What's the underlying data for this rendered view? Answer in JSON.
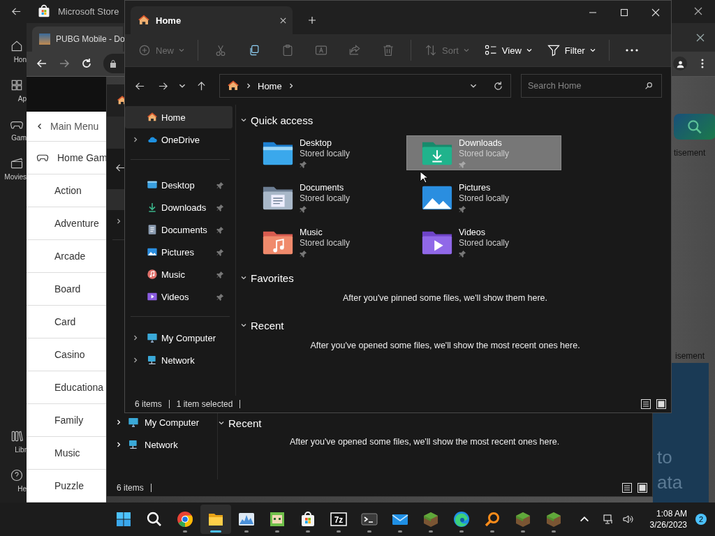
{
  "store": {
    "title": "Microsoft Store",
    "rail": [
      {
        "kind": "home",
        "label": "Hon"
      },
      {
        "kind": "apps",
        "label": "Ap"
      },
      {
        "kind": "gaming",
        "label": "Gam"
      },
      {
        "kind": "movies",
        "label": "Movies"
      }
    ],
    "rail_bottom": [
      {
        "kind": "library",
        "label": "Libr"
      },
      {
        "kind": "help",
        "label": "He"
      }
    ]
  },
  "browser": {
    "tab_title": "PUBG Mobile - Do",
    "menu": {
      "back_label": "Main Menu",
      "section_label": "Home Gam",
      "items": [
        "Action",
        "Adventure",
        "Arcade",
        "Board",
        "Card",
        "Casino",
        "Educationa",
        "Family",
        "Music",
        "Puzzle"
      ]
    },
    "page_snippets": [
      "tisement",
      "isement"
    ],
    "banner_lines": [
      "to",
      "ata"
    ]
  },
  "back_explorer": {
    "nav": [
      {
        "kind": "computer",
        "label": "My Computer"
      },
      {
        "kind": "network",
        "label": "Network"
      }
    ],
    "section": "Recent",
    "message": "After you've opened some files, we'll show the most recent ones here.",
    "status": "6 items"
  },
  "explorer": {
    "tab_title": "Home",
    "toolbar_groups": [
      [
        {
          "kind": "new",
          "label": "New",
          "disabled": true,
          "dropdown": true
        }
      ],
      [
        {
          "kind": "cut",
          "disabled": true
        },
        {
          "kind": "copy",
          "disabled": false
        },
        {
          "kind": "paste",
          "disabled": true
        },
        {
          "kind": "rename",
          "disabled": true
        },
        {
          "kind": "share",
          "disabled": true
        },
        {
          "kind": "delete",
          "disabled": true
        }
      ],
      [
        {
          "kind": "sort",
          "label": "Sort",
          "disabled": true,
          "dropdown": true
        },
        {
          "kind": "view",
          "label": "View",
          "disabled": false,
          "dropdown": true
        },
        {
          "kind": "filter",
          "label": "Filter",
          "disabled": false,
          "dropdown": true
        }
      ],
      [
        {
          "kind": "more",
          "disabled": false
        }
      ]
    ],
    "address": "Home",
    "search_placeholder": "Search Home",
    "nav_groups": [
      [
        {
          "kind": "home",
          "label": "Home",
          "selected": true,
          "expandable": false,
          "pinned": false
        },
        {
          "kind": "onedrive",
          "label": "OneDrive",
          "selected": false,
          "expandable": true,
          "pinned": false
        }
      ],
      [
        {
          "kind": "desktop",
          "label": "Desktop",
          "selected": false,
          "expandable": false,
          "pinned": true
        },
        {
          "kind": "downloads",
          "label": "Downloads",
          "selected": false,
          "expandable": false,
          "pinned": true
        },
        {
          "kind": "documents",
          "label": "Documents",
          "selected": false,
          "expandable": false,
          "pinned": true
        },
        {
          "kind": "pictures",
          "label": "Pictures",
          "selected": false,
          "expandable": false,
          "pinned": true
        },
        {
          "kind": "music",
          "label": "Music",
          "selected": false,
          "expandable": false,
          "pinned": true
        },
        {
          "kind": "videos",
          "label": "Videos",
          "selected": false,
          "expandable": false,
          "pinned": true
        }
      ],
      [
        {
          "kind": "computer",
          "label": "My Computer",
          "selected": false,
          "expandable": true,
          "pinned": false
        },
        {
          "kind": "network",
          "label": "Network",
          "selected": false,
          "expandable": true,
          "pinned": false
        }
      ]
    ],
    "sections": [
      {
        "title": "Quick access",
        "tiles": [
          {
            "kind": "desktop",
            "name": "Desktop",
            "subtitle": "Stored locally",
            "pinned": true,
            "selected": false
          },
          {
            "kind": "downloads",
            "name": "Downloads",
            "subtitle": "Stored locally",
            "pinned": true,
            "selected": true
          },
          {
            "kind": "documents",
            "name": "Documents",
            "subtitle": "Stored locally",
            "pinned": true,
            "selected": false
          },
          {
            "kind": "pictures",
            "name": "Pictures",
            "subtitle": "Stored locally",
            "pinned": true,
            "selected": false
          },
          {
            "kind": "music",
            "name": "Music",
            "subtitle": "Stored locally",
            "pinned": true,
            "selected": false
          },
          {
            "kind": "videos",
            "name": "Videos",
            "subtitle": "Stored locally",
            "pinned": true,
            "selected": false
          }
        ]
      },
      {
        "title": "Favorites",
        "message": "After you've pinned some files, we'll show them here."
      },
      {
        "title": "Recent",
        "message": "After you've opened some files, we'll show the most recent ones here."
      }
    ],
    "status": {
      "count": "6 items",
      "selection": "1 item selected"
    }
  },
  "taskbar": {
    "apps": [
      {
        "kind": "start",
        "selected": false
      },
      {
        "kind": "search",
        "selected": false
      },
      {
        "kind": "chrome",
        "selected": false
      },
      {
        "kind": "folder",
        "selected": true
      },
      {
        "kind": "monitor",
        "selected": false
      },
      {
        "kind": "character",
        "selected": false
      },
      {
        "kind": "store",
        "selected": false
      },
      {
        "kind": "sevenzip",
        "label": "7z",
        "selected": false
      },
      {
        "kind": "terminal",
        "selected": false
      },
      {
        "kind": "mail",
        "selected": false
      },
      {
        "kind": "grass",
        "selected": false
      },
      {
        "kind": "edge",
        "selected": false
      },
      {
        "kind": "magnifier",
        "selected": false
      },
      {
        "kind": "grass",
        "selected": false
      },
      {
        "kind": "grass",
        "selected": false
      }
    ],
    "time": "1:08 AM",
    "date": "3/26/2023",
    "badge": "2"
  }
}
